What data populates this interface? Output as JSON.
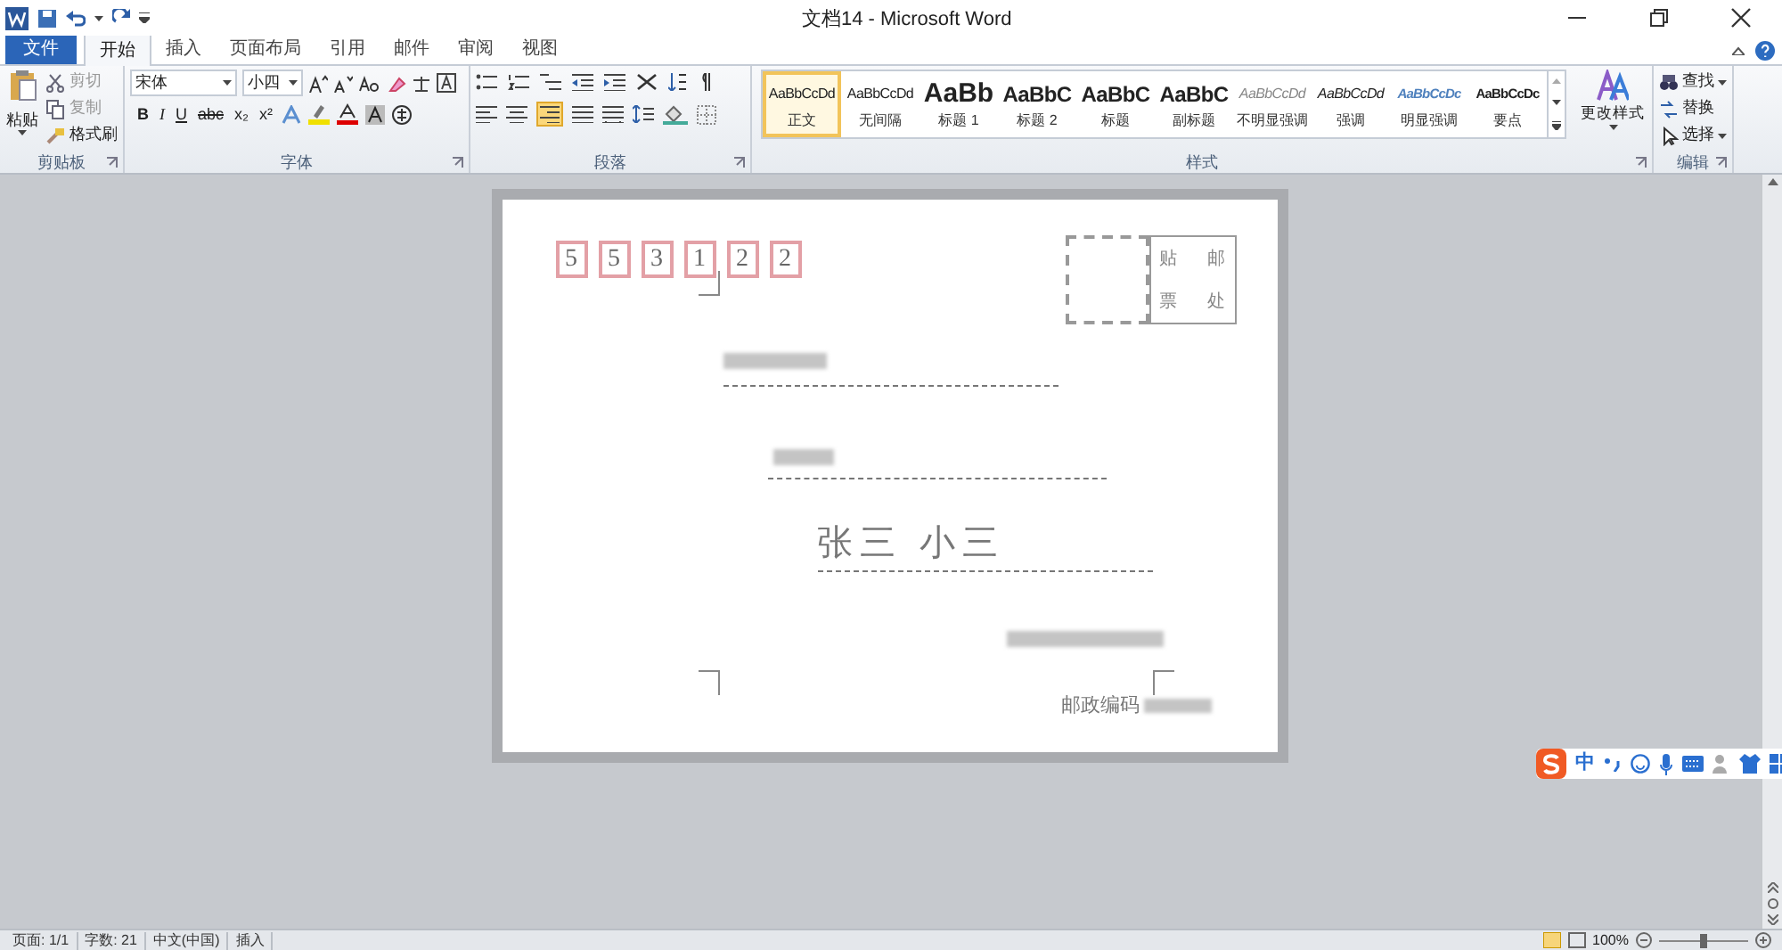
{
  "window": {
    "title": "文档14 - Microsoft Word"
  },
  "tabs": [
    {
      "label": "文件",
      "kind": "file",
      "selected": false
    },
    {
      "label": "开始",
      "kind": "tab",
      "selected": true
    },
    {
      "label": "插入",
      "kind": "tab",
      "selected": false
    },
    {
      "label": "页面布局",
      "kind": "tab",
      "selected": false
    },
    {
      "label": "引用",
      "kind": "tab",
      "selected": false
    },
    {
      "label": "邮件",
      "kind": "tab",
      "selected": false
    },
    {
      "label": "审阅",
      "kind": "tab",
      "selected": false
    },
    {
      "label": "视图",
      "kind": "tab",
      "selected": false
    }
  ],
  "clipboard": {
    "group": "剪贴板",
    "paste": "粘贴",
    "items": [
      "剪切",
      "复制",
      "格式刷"
    ]
  },
  "font": {
    "group": "字体",
    "name": "宋体",
    "size": "小四",
    "format_buttons": [
      {
        "label": "B",
        "kind": "bold"
      },
      {
        "label": "I",
        "kind": "italic"
      },
      {
        "label": "U",
        "kind": "underline"
      },
      {
        "label": "abc",
        "kind": "strike"
      },
      {
        "label": "x₂",
        "kind": "plain"
      },
      {
        "label": "x²",
        "kind": "plain"
      }
    ]
  },
  "paragraph": {
    "group": "段落"
  },
  "styles": {
    "group": "样式",
    "items": [
      {
        "preview": "AaBbCcDd",
        "name": "正文",
        "kind": "normal",
        "selected": true
      },
      {
        "preview": "AaBbCcDd",
        "name": "无间隔",
        "kind": "normal",
        "selected": false
      },
      {
        "preview": "AaBb",
        "name": "标题 1",
        "kind": "h1",
        "selected": false
      },
      {
        "preview": "AaBbC",
        "name": "标题 2",
        "kind": "h2",
        "selected": false
      },
      {
        "preview": "AaBbC",
        "name": "标题",
        "kind": "h2",
        "selected": false
      },
      {
        "preview": "AaBbC",
        "name": "副标题",
        "kind": "h2",
        "selected": false
      },
      {
        "preview": "AaBbCcDd",
        "name": "不明显强调",
        "kind": "subtle",
        "selected": false
      },
      {
        "preview": "AaBbCcDd",
        "name": "强调",
        "kind": "emphasis",
        "selected": false
      },
      {
        "preview": "AaBbCcDc",
        "name": "明显强调",
        "kind": "intense",
        "selected": false
      },
      {
        "preview": "AaBbCcDc",
        "name": "要点",
        "kind": "strong",
        "selected": false
      }
    ]
  },
  "change_styles": "更改样式",
  "editing": {
    "group": "编辑",
    "items": [
      "查找",
      "替换",
      "选择"
    ]
  },
  "envelope": {
    "postcode_digits": [
      "5",
      "5",
      "3",
      "1",
      "2",
      "2"
    ],
    "stamp": [
      "贴",
      "邮",
      "票",
      "处"
    ],
    "recipient_name": "张三 小三",
    "postcode_label": "邮政编码"
  },
  "ime": {
    "mode": "中"
  },
  "status_bar": {
    "items": [
      "页面: 1/1",
      "字数: 21",
      "中文(中国)",
      "插入"
    ],
    "zoom": "100%"
  }
}
